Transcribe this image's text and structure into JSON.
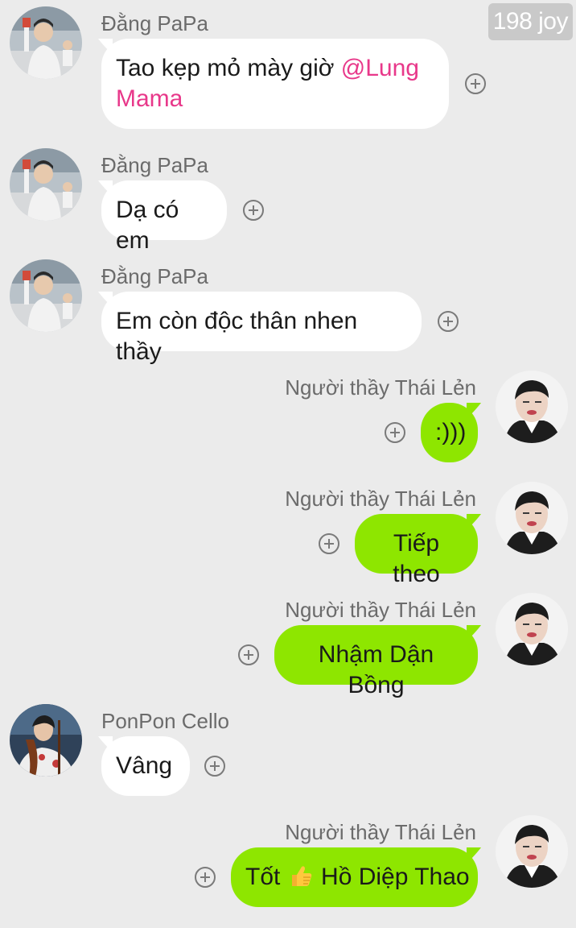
{
  "watermark": "198 joy",
  "users": {
    "dang": "Đằng PaPa",
    "thai": "Người thầy Thái Lẻn",
    "ponpon": "PonPon Cello"
  },
  "messages": [
    {
      "sender": "Đằng PaPa",
      "text_before": "Tao kẹp mỏ mày giờ ",
      "mention_line1": "@Lung",
      "mention_line2": "Mama"
    },
    {
      "sender": "Đằng PaPa",
      "text": "Dạ có em"
    },
    {
      "sender": "Đằng PaPa",
      "text": "Em còn độc thân nhen thầy"
    },
    {
      "sender": "Người thầy Thái Lẻn",
      "text": ":)))"
    },
    {
      "sender": "Người thầy Thái Lẻn",
      "text": "Tiếp theo"
    },
    {
      "sender": "Người thầy Thái Lẻn",
      "text": "Nhậm Dận Bồng"
    },
    {
      "sender": "PonPon Cello",
      "text": "Vâng"
    },
    {
      "sender": "Người thầy Thái Lẻn",
      "text_before": "Tốt ",
      "emoji": "thumbs-up",
      "text_after": " Hồ Diệp Thao"
    }
  ],
  "colors": {
    "background": "#ebebeb",
    "incoming_bubble": "#ffffff",
    "outgoing_bubble": "#8ee600",
    "mention": "#e8388a"
  }
}
